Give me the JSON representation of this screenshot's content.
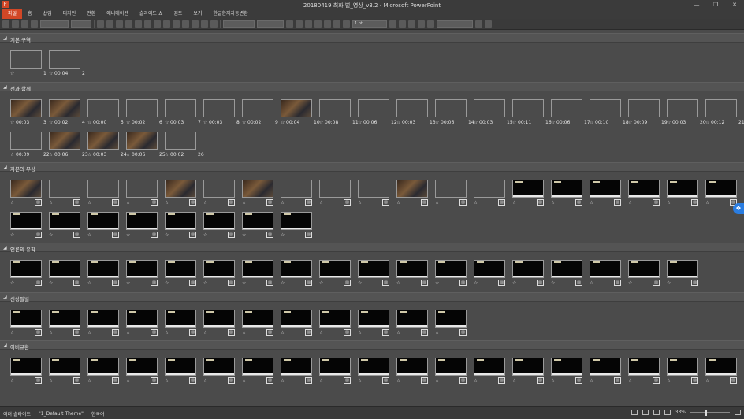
{
  "window": {
    "title": "20180419 최화 벌_영상_v3.2 - Microsoft PowerPoint",
    "app_icon": "P",
    "minimize": "—",
    "restore": "❐",
    "close": "✕"
  },
  "menu": {
    "items": [
      "파일",
      "홈",
      "삽입",
      "디자인",
      "전환",
      "애니메이션",
      "슬라이드 쇼",
      "검토",
      "보기",
      "한글한자자동변환"
    ]
  },
  "toolbar": {
    "line_weight": "1 pt"
  },
  "icons": {
    "star": "☆",
    "no_media": "▨",
    "section_arrow": "◢",
    "dropbox": "❖"
  },
  "sections": [
    {
      "name": "기본 구역",
      "slides": [
        {
          "num": "1",
          "time": "",
          "thumb": "blackimg"
        },
        {
          "num": "2",
          "time": "00:04",
          "thumb": "yellow"
        }
      ]
    },
    {
      "name": "선과 함께",
      "slides": [
        {
          "num": "3",
          "time": "00:03",
          "thumb": "photo"
        },
        {
          "num": "4",
          "time": "00:02",
          "thumb": "photo"
        },
        {
          "num": "5",
          "time": "00:00",
          "thumb": "blue"
        },
        {
          "num": "6",
          "time": "00:02",
          "thumb": "warm"
        },
        {
          "num": "7",
          "time": "00:03",
          "thumb": "light"
        },
        {
          "num": "8",
          "time": "00:03",
          "thumb": "blackimg"
        },
        {
          "num": "9",
          "time": "00:02",
          "thumb": "light"
        },
        {
          "num": "10",
          "time": "00:04",
          "thumb": "photo"
        },
        {
          "num": "11",
          "time": "00:08",
          "thumb": "blackimg"
        },
        {
          "num": "12",
          "time": "00:06",
          "thumb": "blackimg"
        },
        {
          "num": "13",
          "time": "00:03",
          "thumb": "blackimg"
        },
        {
          "num": "14",
          "time": "00:06",
          "thumb": "warm"
        },
        {
          "num": "15",
          "time": "00:03",
          "thumb": "warm"
        },
        {
          "num": "16",
          "time": "00:11",
          "thumb": "warm"
        },
        {
          "num": "17",
          "time": "00:06",
          "thumb": "warm"
        },
        {
          "num": "18",
          "time": "00:10",
          "thumb": "yellow"
        },
        {
          "num": "19",
          "time": "00:09",
          "thumb": "blackimg"
        },
        {
          "num": "20",
          "time": "00:03",
          "thumb": "light"
        },
        {
          "num": "21",
          "time": "00:12",
          "thumb": "blue"
        },
        {
          "num": "22",
          "time": "00:09",
          "thumb": "light"
        },
        {
          "num": "23",
          "time": "00:06",
          "thumb": "photo"
        },
        {
          "num": "24",
          "time": "00:03",
          "thumb": "photo"
        },
        {
          "num": "25",
          "time": "00:06",
          "thumb": "photo"
        },
        {
          "num": "26",
          "time": "00:02",
          "thumb": "blackimg"
        }
      ]
    },
    {
      "name": "자본의 부상",
      "count": 27,
      "photos": 13
    },
    {
      "name": "언론의 유착",
      "count": 18,
      "photos": 0
    },
    {
      "name": "신상필벌",
      "count": 12,
      "photos": 0
    },
    {
      "name": "아버규환",
      "count": 19,
      "photos": 0
    }
  ],
  "status": {
    "slide_sorter": "여러 슬라이드",
    "theme": "\"1_Default Theme\"",
    "language": "한국어",
    "zoom": "33%"
  }
}
